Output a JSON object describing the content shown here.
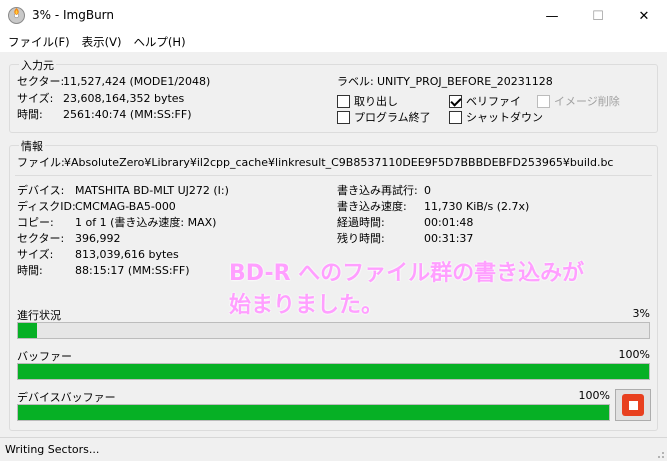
{
  "window": {
    "title": "3% - ImgBurn",
    "minimize": "—",
    "maximize": "☐",
    "close": "✕"
  },
  "menu": [
    "ファイル(F)",
    "表示(V)",
    "ヘルプ(H)"
  ],
  "source": {
    "legend": "入力元",
    "rows": [
      {
        "label": "セクター:",
        "value": "11,527,424 (MODE1/2048)"
      },
      {
        "label": "サイズ:",
        "value": "23,608,164,352 bytes"
      },
      {
        "label": "時間:",
        "value": "2561:40:74 (MM:SS:FF)"
      }
    ],
    "volume_label_key": "ラベル:",
    "volume_label_value": "UNITY_PROJ_BEFORE_20231128",
    "options": {
      "eject": {
        "label": "取り出し",
        "checked": false
      },
      "verify": {
        "label": "ベリファイ",
        "checked": true
      },
      "delete_image": {
        "label": "イメージ削除",
        "checked": false
      },
      "close_program": {
        "label": "プログラム終了",
        "checked": false
      },
      "shutdown": {
        "label": "シャットダウン",
        "checked": false
      }
    }
  },
  "info": {
    "legend": "情報",
    "file_label": "ファイル:",
    "file_value": "¥AbsoluteZero¥Library¥il2cpp_cache¥linkresult_C9B8537110DEE9F5D7BBBDEBFD253965¥build.bc",
    "left_rows": [
      {
        "label": "デバイス:",
        "value": "MATSHITA BD-MLT UJ272 (I:)"
      },
      {
        "label": "ディスクID:",
        "value": "CMCMAG-BA5-000"
      },
      {
        "label": "コピー:",
        "value": "1 of 1 (書き込み速度: MAX)"
      },
      {
        "label": "セクター:",
        "value": "396,992"
      },
      {
        "label": "サイズ:",
        "value": "813,039,616 bytes"
      },
      {
        "label": "時間:",
        "value": "88:15:17 (MM:SS:FF)"
      }
    ],
    "right_rows": [
      {
        "label": "書き込み再試行:",
        "value": "0"
      },
      {
        "label": "書き込み速度:",
        "value": "11,730 KiB/s (2.7x)"
      },
      {
        "label": "経過時間:",
        "value": "00:01:48"
      },
      {
        "label": "残り時間:",
        "value": "00:31:37"
      }
    ]
  },
  "overlay": {
    "line1": "BD-R へのファイル群の書き込みが",
    "line2": "始まりました。"
  },
  "progress": {
    "label": "進行状況",
    "percent_text": "3%",
    "fraction": 0.03
  },
  "buffer": {
    "label": "バッファー",
    "percent_text": "100%",
    "fraction": 1.0
  },
  "device_buffer": {
    "label": "デバイスバッファー",
    "percent_text": "100%",
    "fraction": 1.0
  },
  "status": "Writing Sectors...",
  "colors": {
    "progress_green": "#06b025",
    "stop_red": "#e8401f",
    "overlay_pink": "#ff9fff"
  }
}
